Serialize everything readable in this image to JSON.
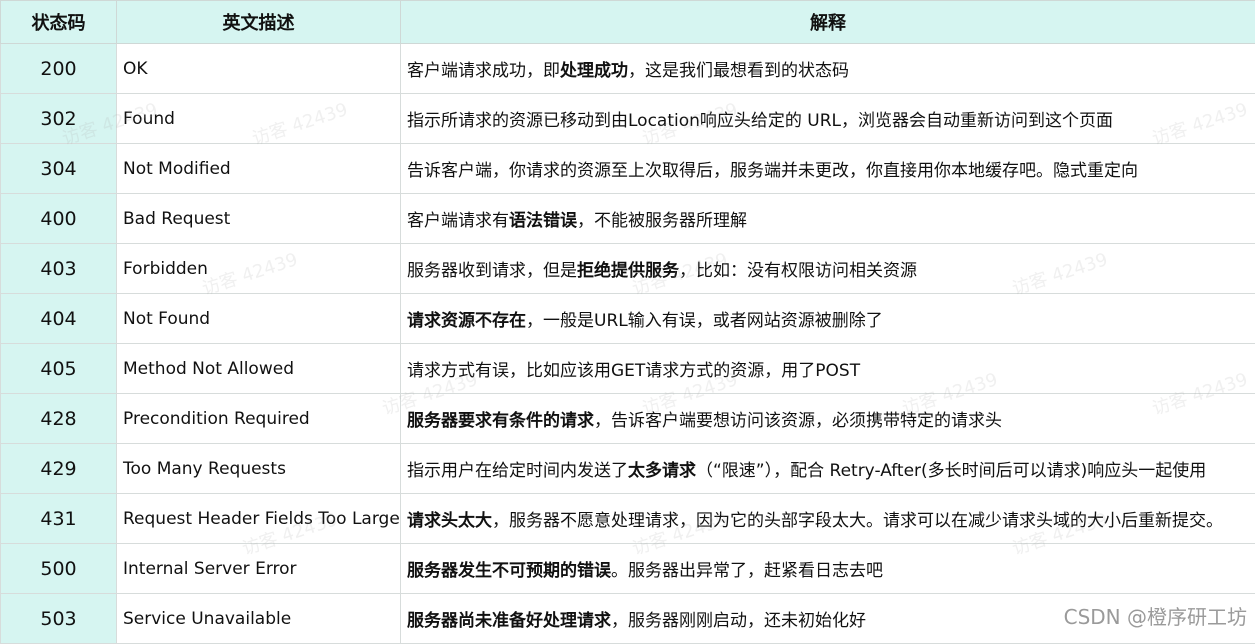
{
  "table": {
    "headers": [
      "状态码",
      "英文描述",
      "解释"
    ],
    "rows": [
      {
        "code": "200",
        "name": "OK",
        "desc": [
          {
            "t": "客户端请求成功，即"
          },
          {
            "t": "处理成功",
            "b": true
          },
          {
            "t": "，这是我们最想看到的状态码"
          }
        ]
      },
      {
        "code": "302",
        "name": "Found",
        "desc": [
          {
            "t": "指示所请求的资源已移动到由Location响应头给定的 URL，浏览器会自动重新访问到这个页面"
          }
        ]
      },
      {
        "code": "304",
        "name": "Not Modified",
        "desc": [
          {
            "t": "告诉客户端，你请求的资源至上次取得后，服务端并未更改，你直接用你本地缓存吧。隐式重定向"
          }
        ]
      },
      {
        "code": "400",
        "name": "Bad Request",
        "desc": [
          {
            "t": "客户端请求有"
          },
          {
            "t": "语法错误",
            "b": true
          },
          {
            "t": "，不能被服务器所理解"
          }
        ]
      },
      {
        "code": "403",
        "name": "Forbidden",
        "desc": [
          {
            "t": "服务器收到请求，但是"
          },
          {
            "t": "拒绝提供服务",
            "b": true
          },
          {
            "t": "，比如：没有权限访问相关资源"
          }
        ]
      },
      {
        "code": "404",
        "name": "Not Found",
        "desc": [
          {
            "t": "请求资源不存在",
            "b": true
          },
          {
            "t": "，一般是URL输入有误，或者网站资源被删除了"
          }
        ]
      },
      {
        "code": "405",
        "name": "Method Not Allowed",
        "desc": [
          {
            "t": "请求方式有误，比如应该用GET请求方式的资源，用了POST"
          }
        ]
      },
      {
        "code": "428",
        "name": "Precondition Required",
        "desc": [
          {
            "t": "服务器要求有条件的请求",
            "b": true
          },
          {
            "t": "，告诉客户端要想访问该资源，必须携带特定的请求头"
          }
        ]
      },
      {
        "code": "429",
        "name": "Too Many Requests",
        "desc": [
          {
            "t": "指示用户在给定时间内发送了"
          },
          {
            "t": "太多请求",
            "b": true
          },
          {
            "t": "（“限速”），配合 Retry-After(多长时间后可以请求)响应头一起使用"
          }
        ]
      },
      {
        "code": "431",
        "name": "Request Header Fields Too Large",
        "desc": [
          {
            "t": "请求头太大",
            "b": true
          },
          {
            "t": "，服务器不愿意处理请求，因为它的头部字段太大。请求可以在减少请求头域的大小后重新提交。"
          }
        ]
      },
      {
        "code": "500",
        "name": "Internal Server Error",
        "desc": [
          {
            "t": "服务器发生不可预期的错误",
            "b": true
          },
          {
            "t": "。服务器出异常了，赶紧看日志去吧"
          }
        ]
      },
      {
        "code": "503",
        "name": "Service Unavailable",
        "desc": [
          {
            "t": "服务器尚未准备好处理请求",
            "b": true
          },
          {
            "t": "，服务器刚刚启动，还未初始化好"
          }
        ]
      }
    ]
  },
  "watermark": {
    "text": "访客 42439"
  },
  "source_label": "CSDN @橙序研工坊",
  "colors": {
    "header_bg": "#d6f5f1",
    "code_col_bg": "#d6f5f1",
    "border": "#d7dcdb"
  }
}
